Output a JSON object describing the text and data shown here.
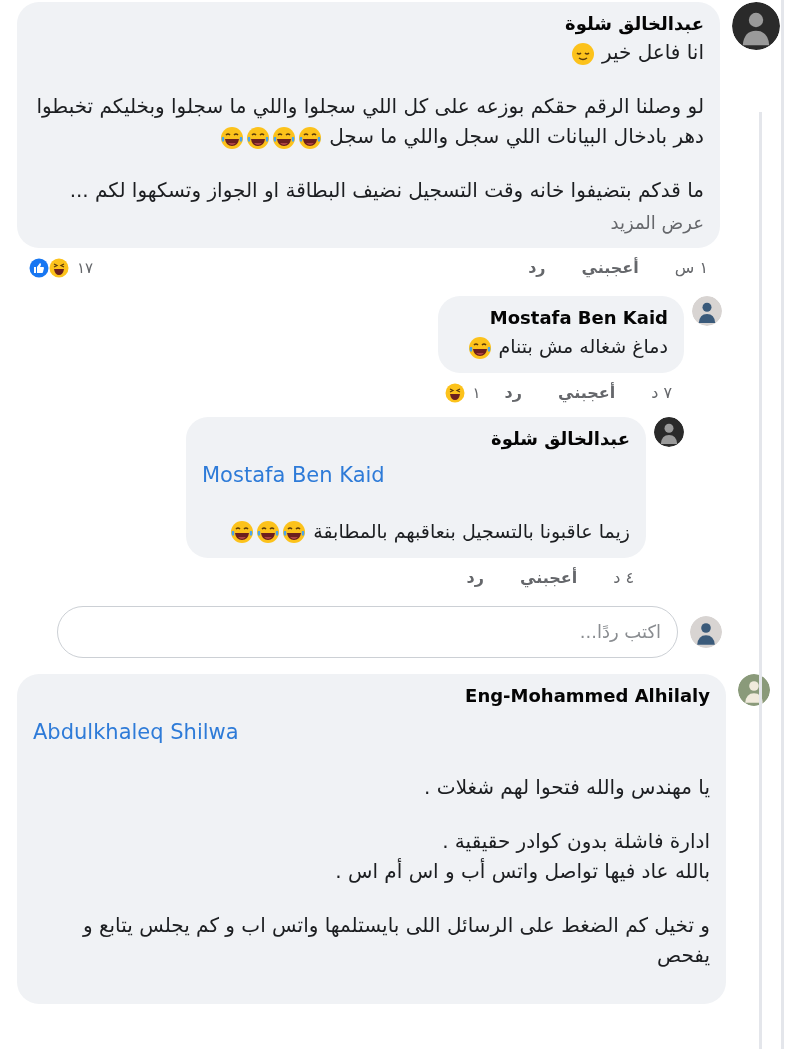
{
  "comments": [
    {
      "kind": "comment",
      "author": "عبدالخالق شلوة",
      "paragraphs": [
        {
          "lines": [
            {
              "text": "انا فاعل خير",
              "emojis": [
                {
                  "kind": "relieved"
                }
              ]
            }
          ]
        },
        {
          "lines": [
            {
              "text": "لو وصلنا الرقم حقكم بوزعه على كل اللي سجلوا واللي ما سجلوا  وبخليكم تخبطوا دهر بادخال البيانات اللي سجل واللي ما سجل",
              "emojis": [
                {
                  "kind": "joy"
                },
                {
                  "kind": "joy"
                },
                {
                  "kind": "joy"
                },
                {
                  "kind": "joy"
                }
              ]
            }
          ]
        },
        {
          "lines": [
            {
              "text": "ما قدكم بتضيفوا خانه وقت التسجيل نضيف البطاقة او الجواز وتسكهوا لكم ..."
            }
          ]
        }
      ],
      "see_more": "عرض المزيد",
      "time": "١ س",
      "like": "أعجبني",
      "reply": "رد",
      "reaction_count": "١٧",
      "reactions": [
        {
          "kind": "like"
        },
        {
          "kind": "haha"
        }
      ],
      "replies": [
        {
          "kind": "reply",
          "author": "Mostafa Ben Kaid",
          "paragraphs": [
            {
              "lines": [
                {
                  "text": "دماغ شغاله مش بتنام",
                  "emojis": [
                    {
                      "kind": "joy"
                    }
                  ]
                }
              ]
            }
          ],
          "time": "٧ د",
          "like": "أعجبني",
          "reply": "رد",
          "reaction_count": "١",
          "reactions": [
            {
              "kind": "haha"
            }
          ]
        },
        {
          "kind": "reply",
          "author": "عبدالخالق شلوة",
          "mention": "Mostafa Ben Kaid",
          "paragraphs": [
            {
              "lines": [
                {
                  "text": "زيما عاقبونا بالتسجيل بنعاقبهم بالمطابقة",
                  "emojis": [
                    {
                      "kind": "joy"
                    },
                    {
                      "kind": "joy"
                    },
                    {
                      "kind": "joy"
                    }
                  ]
                }
              ]
            }
          ],
          "time": "٤ د",
          "like": "أعجبني",
          "reply": "رد"
        }
      ],
      "reply_box": {
        "placeholder": "اكتب ردًا..."
      }
    },
    {
      "kind": "comment",
      "author": "Eng-Mohammed Alhilaly",
      "mention": "Abdulkhaleq Shilwa",
      "paragraphs": [
        {
          "lines": [
            {
              "text": "يا مهندس والله فتحوا لهم شغلات ."
            }
          ]
        },
        {
          "lines": [
            {
              "text": "ادارة فاشلة بدون كوادر حقيقية ."
            },
            {
              "text": "بالله عاد فيها تواصل واتس أب و اس أم اس ."
            }
          ]
        },
        {
          "lines": [
            {
              "text": "و تخيل كم الضغط على الرسائل اللى بايستلمها واتس اب و كم يجلس يتابع و يفحص"
            }
          ]
        }
      ]
    }
  ]
}
